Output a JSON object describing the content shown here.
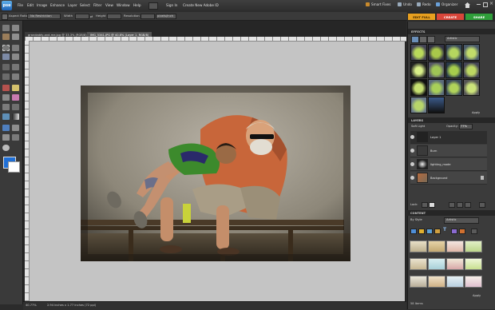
{
  "app": {
    "logo": "pse"
  },
  "menubar": {
    "items": [
      "File",
      "Edit",
      "Image",
      "Enhance",
      "Layer",
      "Select",
      "Filter",
      "View",
      "Window",
      "Help"
    ],
    "sign_in": "Sign In",
    "create_id": "Create New Adobe ID",
    "right": {
      "smart_fixes": "Smart Fixes",
      "undo": "Undo",
      "redo": "Redo",
      "organizer": "Organizer"
    }
  },
  "options": {
    "aspect_label": "Aspect Ratio",
    "aspect_value": "No Restriction",
    "width": "Width",
    "height": "Height",
    "resolution": "Resolution",
    "unit": "pixels/inch"
  },
  "modes": {
    "edit": "EDIT FULL",
    "create": "CREATE",
    "share": "SHARE"
  },
  "document": {
    "tabs": [
      "grandaddy-and-me.jpg @ 33.3% (RGB/8)",
      "IMG_5341.JPG @ 40.8% (Layer 1, RGB/8)"
    ],
    "status_zoom": "40.77%",
    "status_info": "2.94 inches x 1.77 inches (72 ppi)"
  },
  "panels": {
    "effects": {
      "title": "EFFECTS",
      "category": "Artistic",
      "apply": "Apply"
    },
    "layers": {
      "title": "LAYERS",
      "blend": "Soft Light",
      "opacity_label": "Opacity:",
      "opacity_value": "77%",
      "lock_label": "Lock:",
      "items": [
        "Layer 1",
        "Burn",
        "lighting_mode",
        "Background"
      ]
    },
    "content": {
      "title": "CONTENT",
      "by": "By Style",
      "filter": "Artistic",
      "apply": "Apply",
      "footer": "58 Items"
    }
  },
  "colors": {
    "accent_edit": "#e8a01f",
    "accent_create": "#d9463a",
    "accent_share": "#2f9e3a",
    "foreground": "#1f6fd6",
    "background": "#ffffff"
  }
}
